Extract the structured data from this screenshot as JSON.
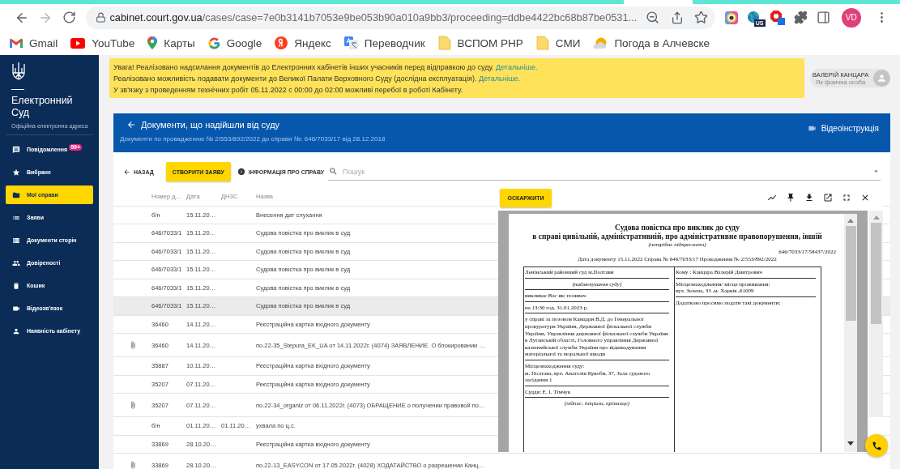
{
  "browser": {
    "forward_disabled": true,
    "url_host": "cabinet.court.gov.ua",
    "url_path": "/cases/case=7e0b3141b7053e9be053b90a010a9bb3/proceeding=ddbe4422bc68b87be0531...",
    "extensions": [
      {
        "kind": "ring"
      },
      {
        "kind": "globe",
        "badge": "US"
      },
      {
        "kind": "blocker"
      },
      {
        "kind": "puzzle"
      }
    ],
    "profile_initials": "VD"
  },
  "bookmarks": [
    {
      "label": "Gmail",
      "kind": "gmail"
    },
    {
      "label": "YouTube",
      "kind": "youtube"
    },
    {
      "label": "Карты",
      "kind": "maps"
    },
    {
      "label": "Google",
      "kind": "google"
    },
    {
      "label": "Яндекс",
      "kind": "yandex"
    },
    {
      "label": "Переводчик",
      "kind": "translate"
    },
    {
      "label": "ВСПОМ РНР",
      "kind": "folder"
    },
    {
      "label": "СМИ",
      "kind": "folder"
    },
    {
      "label": "Погода в Алчевске",
      "kind": "weather"
    }
  ],
  "sidebar": {
    "brand": "Електронний Суд",
    "tagline": "Офіційна електронна адреса",
    "items": [
      {
        "label": "Повідомлення",
        "kind": "messages",
        "badge": "99+",
        "selected": false
      },
      {
        "label": "Вибране",
        "kind": "favorites",
        "selected": false
      },
      {
        "label": "Мої справи",
        "kind": "cases",
        "selected": true
      },
      {
        "label": "Заяви",
        "kind": "list",
        "selected": false
      },
      {
        "label": "Документи сторін",
        "kind": "documents",
        "selected": false
      },
      {
        "label": "Довіреності",
        "kind": "people",
        "selected": false
      },
      {
        "label": "Кошик",
        "kind": "trash",
        "selected": false
      },
      {
        "label": "Відеозв'язок",
        "kind": "video",
        "selected": false
      },
      {
        "label": "Наявність кабінету",
        "kind": "person",
        "selected": false
      }
    ]
  },
  "notices": [
    {
      "text": "Увага! Реалізовано надсилання документів до Електронних кабінетів інших учасників перед відправкою до суду.",
      "link": "Детальніше."
    },
    {
      "text": "Реалізовано можливість подавати документи до Великої Палати Верховного Суду (дослідна експлуатація).",
      "link": "Детальніше."
    },
    {
      "text": "У зв'язку з проведенням технічних робіт 05.11.2022 с 00:00 до 02:00 можливі перебої в роботі Кабінету."
    }
  ],
  "user": {
    "name": "ВАЛЕРІЙ КАНЦАРА",
    "role": "Як фізична особа"
  },
  "header": {
    "title": "Документи, що надійшли від суду",
    "subtitle": "Документи по провадженню № 2/553/892/2022 до справи №: 646/7033/17 від 28.12.2018",
    "video_link": "Відеоінструкція"
  },
  "toolbar": {
    "back": "НАЗАД",
    "create": "СТВОРИТИ ЗАЯВУ",
    "info": "ІНФОРМАЦІЯ ПРО СПРАВУ",
    "search_placeholder": "Пошук"
  },
  "table": {
    "columns": [
      "Номер д…",
      "Дата",
      "ДНЗС",
      "Назва"
    ],
    "rows": [
      {
        "number": "б/н",
        "date": "15.11.20…",
        "name": "Внесення дат слухання",
        "attachment": false,
        "selected": false
      },
      {
        "number": "646/7033/1",
        "date": "15.11.20…",
        "name": "Судова повістка про виклик в суд",
        "attachment": false,
        "selected": false
      },
      {
        "number": "646/7033/1",
        "date": "15.11.20…",
        "name": "Судова повістка про виклик в суд",
        "attachment": false,
        "selected": false
      },
      {
        "number": "646/7033/1",
        "date": "15.11.20…",
        "name": "Судова повістка про виклик в суд",
        "attachment": false,
        "selected": false
      },
      {
        "number": "646/7033/1",
        "date": "15.11.20…",
        "name": "Судова повістка про виклик в суд",
        "attachment": false,
        "selected": false
      },
      {
        "number": "646/7033/1",
        "date": "15.11.20…",
        "name": "Судова повістка про виклик в суд",
        "attachment": false,
        "selected": true
      },
      {
        "number": "36460",
        "date": "14.11.20…",
        "name": "Реєстраційна картка вхідного документу",
        "attachment": false,
        "selected": false
      },
      {
        "number": "36460",
        "date": "14.11.20…",
        "name": "по.22-35_Stepura_EK_UA от 14.11.2022г. (4074) ЗАЯВЛЕНИЕ. О блокировании …",
        "attachment": true,
        "selected": false
      },
      {
        "number": "35887",
        "date": "10.11.20…",
        "name": "Реєстраційна картка вхідного документу",
        "attachment": false,
        "selected": false
      },
      {
        "number": "35207",
        "date": "07.11.20…",
        "name": "Реєстраційна картка вхідного документу",
        "attachment": false,
        "selected": false
      },
      {
        "number": "35207",
        "date": "07.11.20…",
        "name": "по.22-34_organiz от 06.11.2022г. (4073) ОБРАЩЕНИЕ о получении правовой по…",
        "attachment": true,
        "selected": false
      },
      {
        "number": "б/н",
        "date": "01.11.20…",
        "dnzs": "01.11.20…",
        "name": "ухвала по ц.с.",
        "attachment": false,
        "selected": false
      },
      {
        "number": "33869",
        "date": "28.10.20…",
        "name": "Реєстраційна картка вхідного документу",
        "attachment": false,
        "selected": false
      },
      {
        "number": "33869",
        "date": "28.10.20…",
        "name": "по.22-13_EASYCON от 17.05.2022г. (4028) ХОДАТАЙСТВО о разрешении Канц…",
        "attachment": true,
        "selected": false
      }
    ]
  },
  "viewer": {
    "appeal": "ОСКАРЖИТИ",
    "document": {
      "title": "Судова повістка про виклик до суду",
      "subtitle": "в справі цивільній, адміністративній, про адміністративне правопорушення, іншій",
      "hint": "(потрібне підкреслити)",
      "number": "646/7033/17/58437/2022",
      "meta": "Дата документу 15.11.2022 Справа № 646/7033/17 Провадження № 2/553/892/2022",
      "left": [
        {
          "kind": "text",
          "lines": [
            "Ленінський районний суд м.Полтави"
          ]
        },
        {
          "kind": "caption",
          "lines": [
            "(найменування суду)"
          ]
        },
        {
          "kind": "text",
          "lines": [
            "викликає Вас як: позивач"
          ]
        },
        {
          "kind": "text",
          "lines": [
            "на 13:30 год. 31.01.2023 р."
          ]
        },
        {
          "kind": "text",
          "lines": [
            "у справі за позовом Канцари В.Д. до Генеральної прокуратури України, Державної фіскальної служби України, Управління державної фіскальної служби України в Луганській області, Головного управління Державної казначейської служби України про відшкодування матеріальної та моральної шкоди"
          ]
        },
        {
          "kind": "text",
          "lines": [
            "Місцезнаходження суду:",
            "м. Полтава, вул. Анатолія Кукоби, 37, Зала судового засідання 1"
          ]
        },
        {
          "kind": "text",
          "lines": [
            "Суддя: Е. І. Тімчук"
          ]
        },
        {
          "kind": "caption",
          "lines": [
            "(підпис, ініціали, прізвище)"
          ]
        }
      ],
      "right": [
        {
          "kind": "text",
          "lines": [
            "Кому : Канцара Валерій Дмитрович"
          ]
        },
        {
          "kind": "text",
          "lines": [
            "Місцезнаходження/ місце проживання:",
            "вул. Зелена, 33 ,м. Харків ,61009"
          ]
        },
        {
          "kind": "text",
          "lines": [
            "Додатково просимо подати такі документи:"
          ]
        }
      ]
    }
  }
}
